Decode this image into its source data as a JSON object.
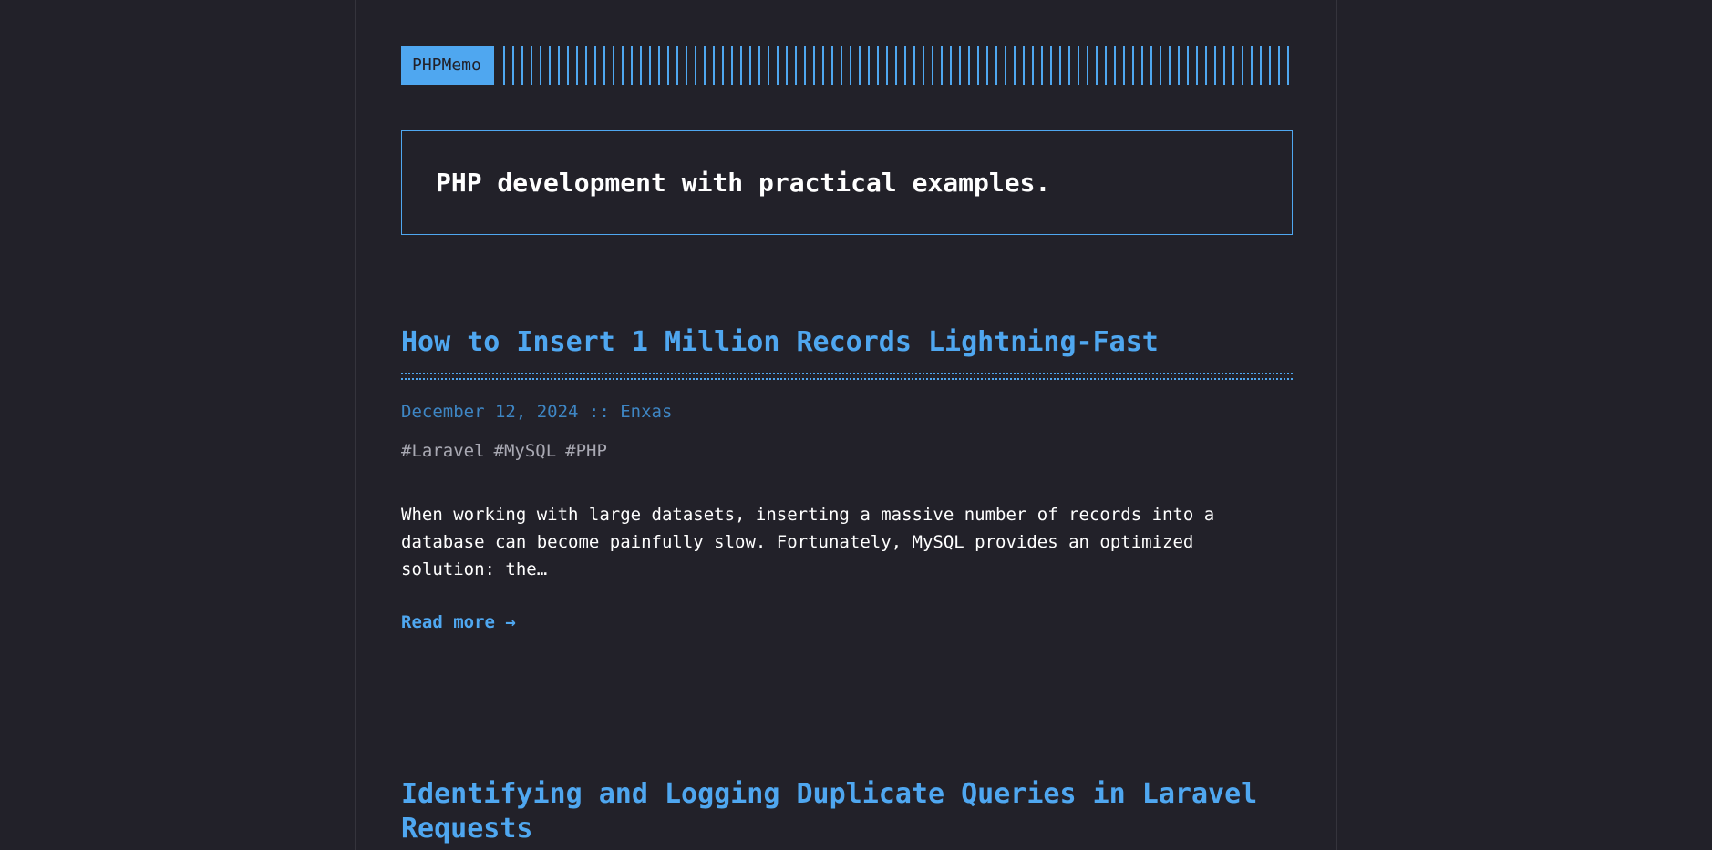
{
  "header": {
    "logo_text": "PHPMemo"
  },
  "banner": {
    "tagline": "PHP development with practical examples."
  },
  "posts": [
    {
      "title": "How to Insert 1 Million Records Lightning-Fast",
      "meta": "December 12, 2024 :: Enxas",
      "tags": [
        "#Laravel",
        "#MySQL",
        "#PHP"
      ],
      "excerpt": "When working with large datasets, inserting a massive number of records into a database can become painfully slow. Fortunately, MySQL provides an optimized solution: the…",
      "read_more": "Read more →"
    },
    {
      "title": "Identifying and Logging Duplicate Queries in Laravel Requests"
    }
  ],
  "colors": {
    "background": "#222129",
    "accent": "#4fa7f0",
    "meta": "#3e86c4",
    "tag": "#a9a9b3",
    "text": "#ffffff"
  }
}
